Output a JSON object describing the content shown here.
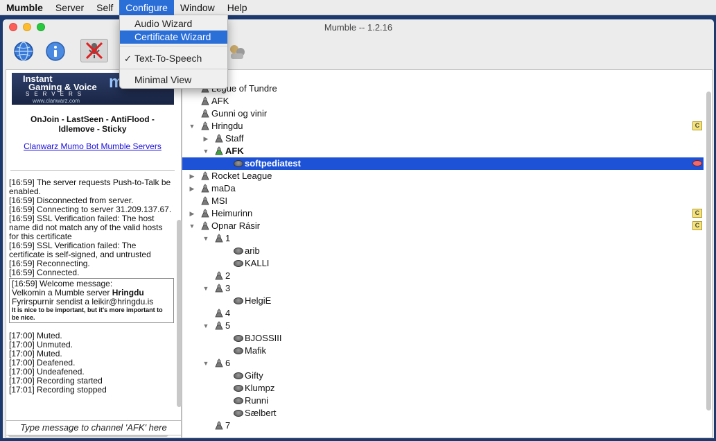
{
  "menubar": {
    "app": "Mumble",
    "items": [
      "Server",
      "Self",
      "Configure",
      "Window",
      "Help"
    ]
  },
  "menu": {
    "items": [
      {
        "label": "Audio Wizard",
        "highlighted": false,
        "checked": false
      },
      {
        "label": "Certificate Wizard",
        "highlighted": true,
        "checked": false
      },
      {
        "label": "Text-To-Speech",
        "highlighted": false,
        "checked": true
      },
      {
        "label": "Minimal View",
        "highlighted": false,
        "checked": false
      }
    ]
  },
  "window": {
    "title": "Mumble -- 1.2.16"
  },
  "banner": {
    "line1": "Instant",
    "line2": "Gaming & Voice",
    "servers": "SERVERS",
    "url": "www.clanwarz.com",
    "brand": "mu"
  },
  "info": {
    "plugins_line1": "OnJoin - LastSeen - AntiFlood -",
    "plugins_line2": "Idlemove - Sticky",
    "link": "Clanwarz Mumo Bot Mumble Servers"
  },
  "log": {
    "lines_before": [
      "[16:59] The server requests Push-to-Talk be enabled.",
      "[16:59] Disconnected from server.",
      "[16:59] Connecting to server 31.209.137.67.",
      "[16:59] SSL Verification failed: The host name did not match any of the valid hosts for this certificate",
      "[16:59] SSL Verification failed: The certificate is self-signed, and untrusted",
      "[16:59] Reconnecting.",
      "[16:59] Connected."
    ],
    "welcome_prefix": "[16:59] Welcome message:",
    "welcome_text": "Velkomin a Mumble server ",
    "welcome_bold": "Hringdu",
    "welcome_contact": "Fyrirspurnir sendist a leikir@hringdu.is",
    "welcome_small": "It is nice to be important, but it's more important to be nice.",
    "lines_after": [
      "[17:00] Muted.",
      "[17:00] Unmuted.",
      "[17:00] Muted.",
      "[17:00] Deafened.",
      "[17:00] Undeafened.",
      "[17:00] Recording started",
      "[17:01] Recording stopped"
    ]
  },
  "chat_input": {
    "placeholder": "Type message to channel 'AFK' here"
  },
  "tree": [
    {
      "type": "channel",
      "label": "ehf",
      "depth": 0,
      "arrow": ""
    },
    {
      "type": "channel",
      "label": "Legue of Tundre",
      "depth": 0,
      "arrow": ""
    },
    {
      "type": "channel",
      "label": "AFK",
      "depth": 0,
      "arrow": ""
    },
    {
      "type": "channel",
      "label": "Gunni og vinir",
      "depth": 0,
      "arrow": ""
    },
    {
      "type": "channel",
      "label": "Hringdu",
      "depth": 0,
      "arrow": "open",
      "comment": true
    },
    {
      "type": "channel",
      "label": "Staff",
      "depth": 1,
      "arrow": "closed"
    },
    {
      "type": "channel",
      "label": "AFK",
      "depth": 1,
      "arrow": "open",
      "bold": true,
      "current": true
    },
    {
      "type": "user",
      "label": "softpediatest",
      "depth": 2,
      "selected": true,
      "talking": true
    },
    {
      "type": "channel",
      "label": "Rocket League",
      "depth": 0,
      "arrow": "closed"
    },
    {
      "type": "channel",
      "label": "maDa",
      "depth": 0,
      "arrow": "closed"
    },
    {
      "type": "channel",
      "label": "MSI",
      "depth": 0,
      "arrow": ""
    },
    {
      "type": "channel",
      "label": "Heimurinn",
      "depth": 0,
      "arrow": "closed",
      "comment": true
    },
    {
      "type": "channel",
      "label": "Opnar Rásir",
      "depth": 0,
      "arrow": "open",
      "comment": true
    },
    {
      "type": "channel",
      "label": "1",
      "depth": 1,
      "arrow": "open"
    },
    {
      "type": "user",
      "label": "arib",
      "depth": 2
    },
    {
      "type": "user",
      "label": "KALLI",
      "depth": 2
    },
    {
      "type": "channel",
      "label": "2",
      "depth": 1,
      "arrow": ""
    },
    {
      "type": "channel",
      "label": "3",
      "depth": 1,
      "arrow": "open"
    },
    {
      "type": "user",
      "label": "HelgiE",
      "depth": 2
    },
    {
      "type": "channel",
      "label": "4",
      "depth": 1,
      "arrow": ""
    },
    {
      "type": "channel",
      "label": "5",
      "depth": 1,
      "arrow": "open"
    },
    {
      "type": "user",
      "label": "BJOSSIII",
      "depth": 2
    },
    {
      "type": "user",
      "label": "Mafik",
      "depth": 2
    },
    {
      "type": "channel",
      "label": "6",
      "depth": 1,
      "arrow": "open"
    },
    {
      "type": "user",
      "label": "Gifty",
      "depth": 2
    },
    {
      "type": "user",
      "label": "Klumpz",
      "depth": 2
    },
    {
      "type": "user",
      "label": "Runni",
      "depth": 2
    },
    {
      "type": "user",
      "label": "Sælbert",
      "depth": 2
    },
    {
      "type": "channel",
      "label": "7",
      "depth": 1,
      "arrow": ""
    }
  ],
  "icons": {
    "comment_glyph": "C",
    "arrow_open": "▼",
    "arrow_closed": "▶"
  },
  "colors": {
    "selection": "#1d52d6",
    "menu_highlight": "#2a6ed8",
    "comment_badge": "#f4e27a",
    "talking": "#ef6b6b"
  }
}
